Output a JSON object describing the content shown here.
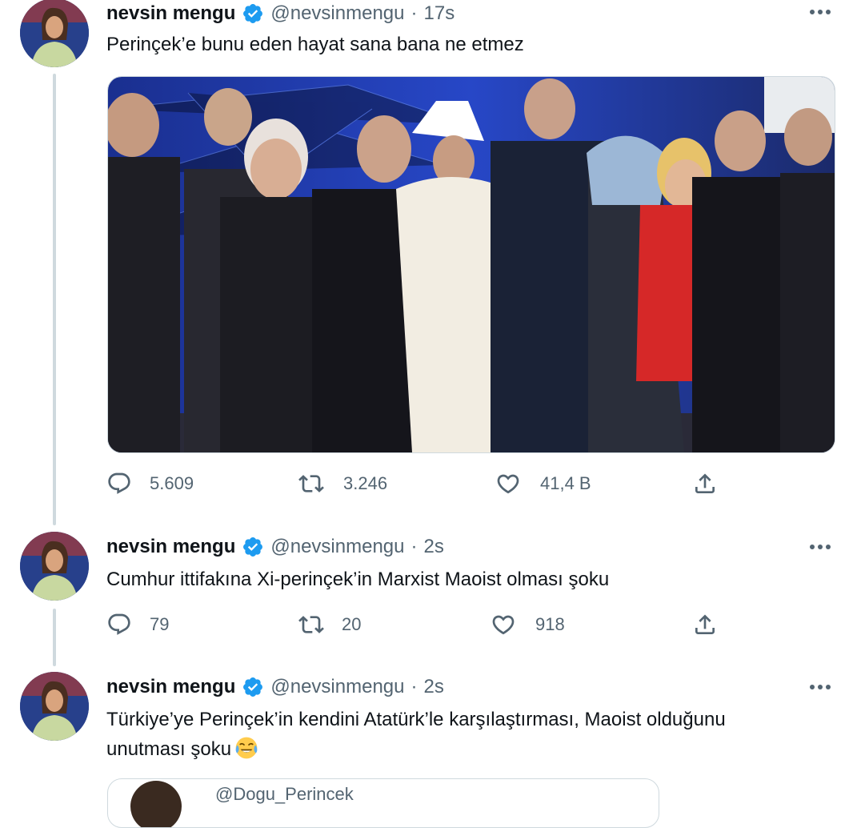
{
  "colors": {
    "text": "#0f1419",
    "muted": "#536471",
    "verified": "#1d9bf0",
    "border": "#cfd9de"
  },
  "tweets": [
    {
      "name": "nevsin mengu",
      "handle": "@nevsinmengu",
      "separator": "·",
      "time": "17s",
      "text": "Perinçek’e bunu eden hayat sana bana ne etmez",
      "has_media": true,
      "replies": "5.609",
      "retweets": "3.246",
      "likes": "41,4 B"
    },
    {
      "name": "nevsin mengu",
      "handle": "@nevsinmengu",
      "separator": "·",
      "time": "2s",
      "text": "Cumhur ittifakına Xi-perinçek’in Marxist Maoist olması şoku",
      "replies": "79",
      "retweets": "20",
      "likes": "918"
    },
    {
      "name": "nevsin mengu",
      "handle": "@nevsinmengu",
      "separator": "·",
      "time": "2s",
      "text_line1": "Türkiye’ye Perinçek’in kendini Atatürk’le karşılaştırması, Maoist olduğunu",
      "text_line2": "unutması şoku",
      "emoji": "face-with-tears-of-joy",
      "quote_handle": "@Dogu_Perincek"
    }
  ],
  "icons": {
    "reply": "reply-icon",
    "retweet": "retweet-icon",
    "like": "like-icon",
    "share": "share-icon",
    "more": "more-icon",
    "verified": "verified-badge-icon"
  }
}
